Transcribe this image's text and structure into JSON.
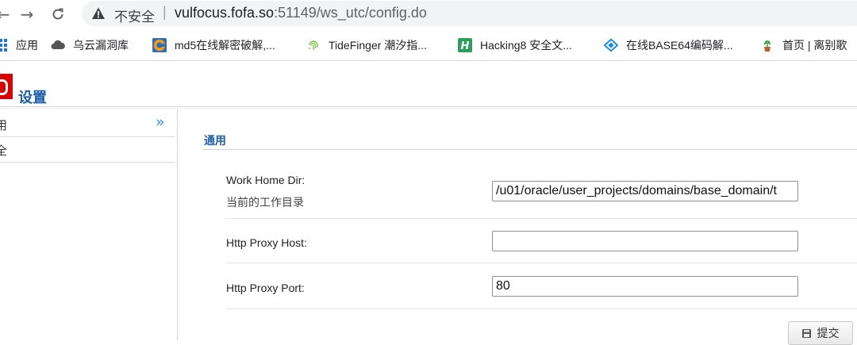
{
  "browser": {
    "security_label": "不安全",
    "separator": "|",
    "url_host": "vulfocus.fofa.so",
    "url_rest": ":51149/ws_utc/config.do",
    "nav_back_icon": "back-arrow-icon",
    "nav_forward_icon": "forward-arrow-icon",
    "nav_reload_icon": "reload-icon",
    "security_icon": "warning-triangle-icon"
  },
  "bookmarks": [
    {
      "label": "应用",
      "icon": "apps-grid-icon"
    },
    {
      "label": "乌云漏洞库",
      "icon": "cloud-icon"
    },
    {
      "label": "md5在线解密破解,...",
      "icon": "orange-c-icon"
    },
    {
      "label": "TideFinger 潮汐指...",
      "icon": "fingerprint-icon"
    },
    {
      "label": "Hacking8 安全文...",
      "icon": "h-logo-icon"
    },
    {
      "label": "在线BASE64编码解...",
      "icon": "diamond-icon"
    },
    {
      "label": "首页 | 离别歌",
      "icon": "plant-icon"
    }
  ],
  "header": {
    "title": "设置",
    "logo_color": "#d90000"
  },
  "sidebar": {
    "items": [
      {
        "label": "用"
      },
      {
        "label": "全"
      }
    ],
    "collapse_icon": "double-chevron-right-icon"
  },
  "form": {
    "section_title": "通用",
    "work_home": {
      "label": "Work Home Dir:",
      "sublabel": "当前的工作目录",
      "value": "/u01/oracle/user_projects/domains/base_domain/t"
    },
    "proxy_host": {
      "label": "Http Proxy Host:",
      "value": ""
    },
    "proxy_port": {
      "label": "Http Proxy Port:",
      "value": "80"
    },
    "submit_label": "提交",
    "submit_icon": "save-disk-icon"
  },
  "colors": {
    "accent_blue": "#1f5fa8",
    "chevron_blue": "#3c8dd8"
  }
}
